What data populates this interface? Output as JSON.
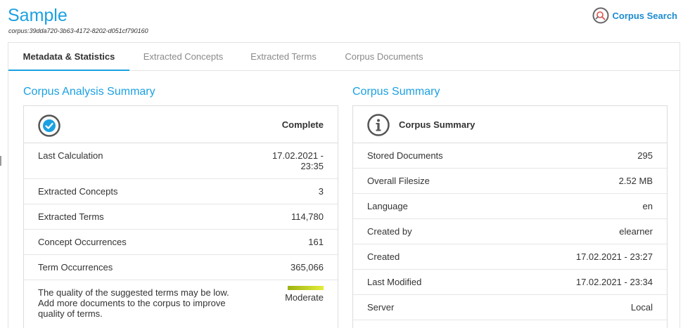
{
  "header": {
    "title": "Sample",
    "corpus_id": "corpus:39dda720-3b63-4172-8202-d051cf790160",
    "corpus_search_label": "Corpus Search",
    "corpus_search_icon": "corpus-search-icon"
  },
  "tabs": [
    {
      "label": "Metadata & Statistics",
      "active": true
    },
    {
      "label": "Extracted Concepts",
      "active": false
    },
    {
      "label": "Extracted Terms",
      "active": false
    },
    {
      "label": "Corpus Documents",
      "active": false
    }
  ],
  "analysis": {
    "section_title": "Corpus Analysis Summary",
    "status_icon": "check-circle-icon",
    "status": "Complete",
    "rows": [
      {
        "label": "Last Calculation",
        "value_line1": "17.02.2021 -",
        "value_line2": "23:35"
      },
      {
        "label": "Extracted Concepts",
        "value": "3"
      },
      {
        "label": "Extracted Terms",
        "value": "114,780"
      },
      {
        "label": "Concept Occurrences",
        "value": "161"
      },
      {
        "label": "Term Occurrences",
        "value": "365,066"
      }
    ],
    "quality": {
      "text": "The quality of the suggested terms may be low. Add more documents to the corpus to improve quality of terms.",
      "level": "Moderate",
      "bar_colors": [
        "#9eb212",
        "#e3ee3a"
      ]
    }
  },
  "summary": {
    "section_title": "Corpus Summary",
    "header_icon": "info-circle-icon",
    "header_label": "Corpus Summary",
    "rows": [
      {
        "label": "Stored Documents",
        "value": "295"
      },
      {
        "label": "Overall Filesize",
        "value": "2.52 MB"
      },
      {
        "label": "Language",
        "value": "en"
      },
      {
        "label": "Created by",
        "value": "elearner"
      },
      {
        "label": "Created",
        "value": "17.02.2021 - 23:27"
      },
      {
        "label": "Last Modified",
        "value": "17.02.2021 - 23:34"
      },
      {
        "label": "Server",
        "value": "Local"
      }
    ]
  },
  "colors": {
    "accent": "#1ba1e2",
    "link": "#1b8cd1",
    "search_icon": "#d9534f"
  }
}
